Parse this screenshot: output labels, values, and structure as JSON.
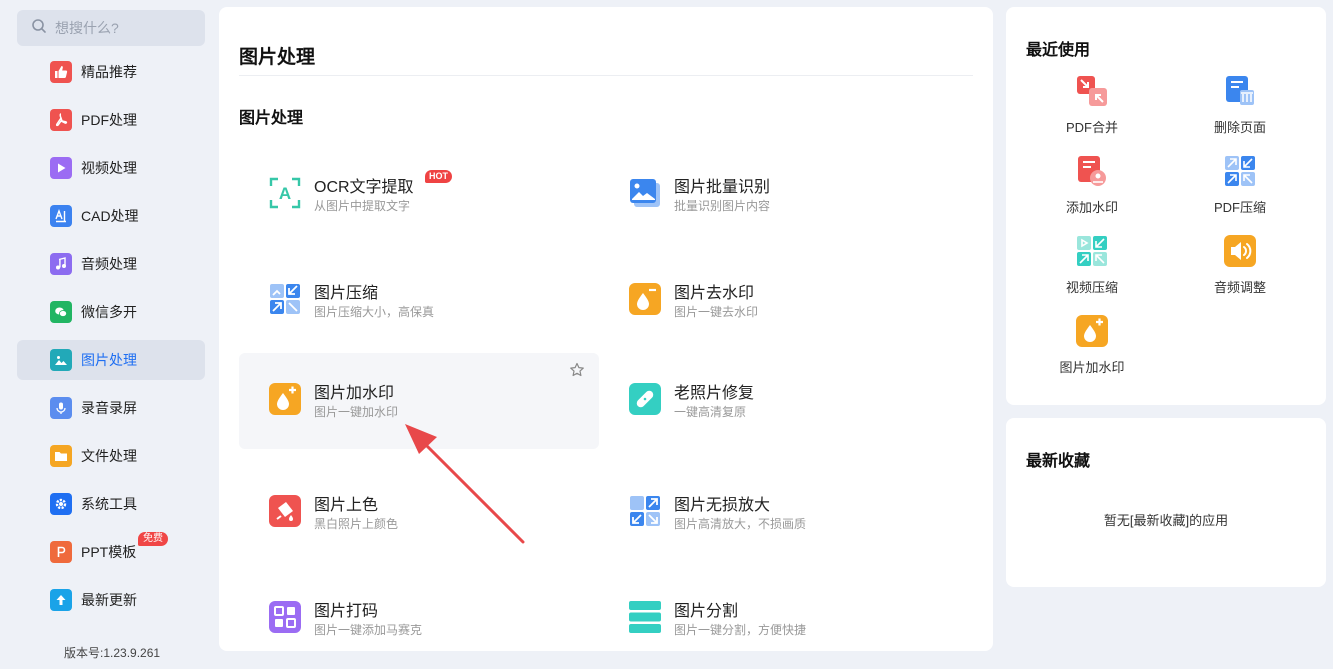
{
  "search": {
    "placeholder": "想搜什么?"
  },
  "sidebar": {
    "items": [
      {
        "label": "精品推荐"
      },
      {
        "label": "PDF处理"
      },
      {
        "label": "视频处理"
      },
      {
        "label": "CAD处理"
      },
      {
        "label": "音频处理"
      },
      {
        "label": "微信多开"
      },
      {
        "label": "图片处理",
        "active": true
      },
      {
        "label": "录音录屏"
      },
      {
        "label": "文件处理"
      },
      {
        "label": "系统工具"
      },
      {
        "label": "PPT模板",
        "badge": "免费"
      },
      {
        "label": "最新更新"
      }
    ],
    "version": "版本号:1.23.9.261"
  },
  "main": {
    "title": "图片处理",
    "section": "图片处理",
    "tools": [
      {
        "name": "OCR文字提取",
        "desc": "从图片中提取文字",
        "badge": "HOT"
      },
      {
        "name": "图片批量识别",
        "desc": "批量识别图片内容"
      },
      {
        "name": "图片压缩",
        "desc": "图片压缩大小，高保真"
      },
      {
        "name": "图片去水印",
        "desc": "图片一键去水印"
      },
      {
        "name": "图片加水印",
        "desc": "图片一键加水印"
      },
      {
        "name": "老照片修复",
        "desc": "一键高清复原"
      },
      {
        "name": "图片上色",
        "desc": "黑白照片上颜色"
      },
      {
        "name": "图片无损放大",
        "desc": "图片高清放大，不损画质"
      },
      {
        "name": "图片打码",
        "desc": "图片一键添加马赛克"
      },
      {
        "name": "图片分割",
        "desc": "图片一键分割，方便快捷"
      }
    ]
  },
  "recent": {
    "title": "最近使用",
    "items": [
      {
        "label": "PDF合并"
      },
      {
        "label": "删除页面"
      },
      {
        "label": "添加水印"
      },
      {
        "label": "PDF压缩"
      },
      {
        "label": "视频压缩"
      },
      {
        "label": "音频调整"
      },
      {
        "label": "图片加水印"
      }
    ]
  },
  "favorites": {
    "title": "最新收藏",
    "empty_text": "暂无[最新收藏]的应用"
  },
  "colors": {
    "accent": "#1f6ff2",
    "hot_badge": "#ef4343",
    "annotation_arrow": "#e8484a"
  }
}
